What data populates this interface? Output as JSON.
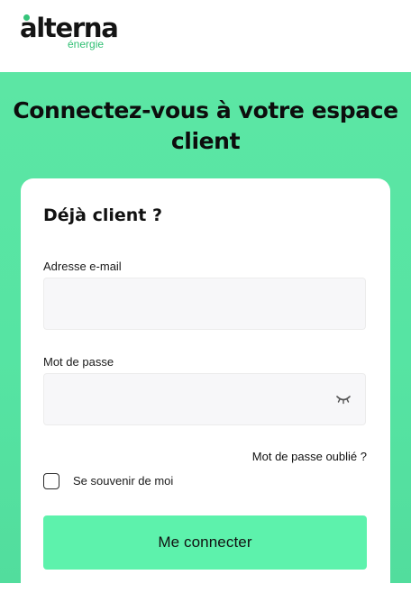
{
  "brand": {
    "name": "alterna",
    "tagline": "énergie",
    "accent_color": "#35c47a"
  },
  "hero": {
    "title": "Connectez-vous à votre espace client",
    "background_color": "#5ce6a4"
  },
  "login_form": {
    "title": "Déjà client ?",
    "email": {
      "label": "Adresse e-mail",
      "value": "",
      "placeholder": ""
    },
    "password": {
      "label": "Mot de passe",
      "value": "",
      "placeholder": "",
      "toggle_icon": "eye-closed-icon"
    },
    "forgot_password_label": "Mot de passe oublié ?",
    "remember_me": {
      "label": "Se souvenir de moi",
      "checked": false
    },
    "submit_label": "Me connecter",
    "button_color": "#5df2ac"
  }
}
